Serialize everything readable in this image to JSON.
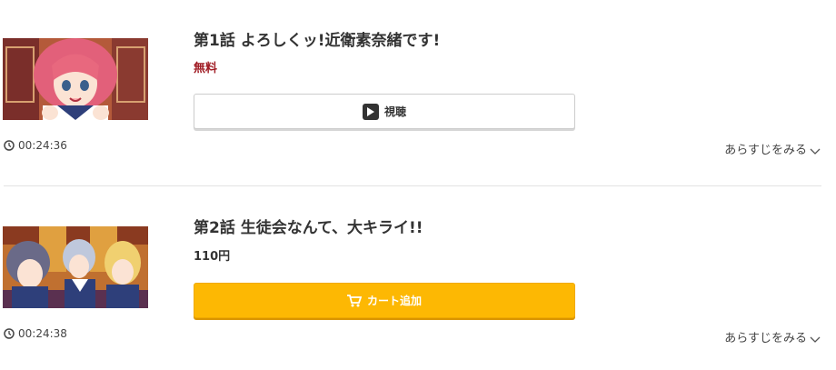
{
  "episodes": [
    {
      "title": "第1話 よろしくッ!近衛素奈緒です!",
      "price": "無料",
      "button_label": "視聴",
      "button_icon": "play-icon",
      "duration": "00:24:36",
      "synopsis_label": "あらすじをみる"
    },
    {
      "title": "第2話 生徒会なんて、大キライ!!",
      "price": "110円",
      "button_label": "カート追加",
      "button_icon": "cart-icon",
      "duration": "00:24:38",
      "synopsis_label": "あらすじをみる"
    }
  ],
  "colors": {
    "free_price": "#a01c24",
    "cart_button": "#fdb803",
    "divider": "#e3e3e3"
  }
}
